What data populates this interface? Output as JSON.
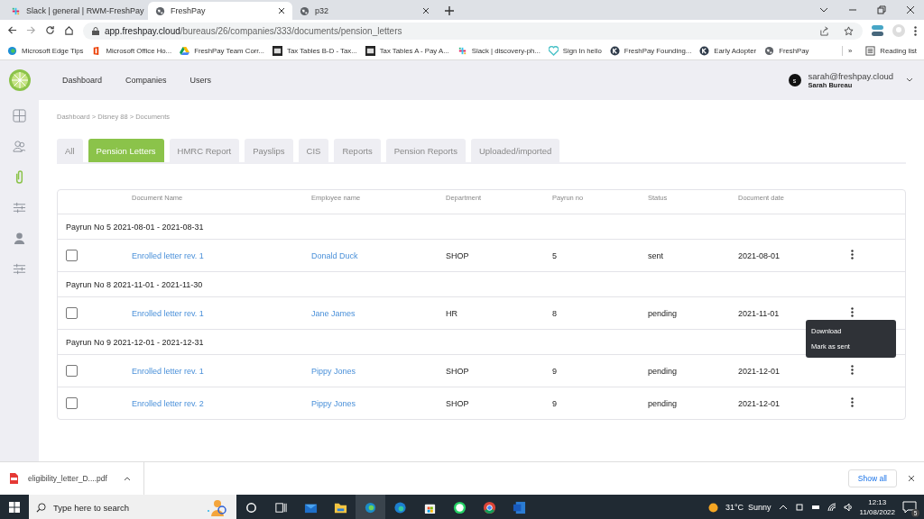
{
  "browser": {
    "tabs": [
      {
        "title": "Slack | general | RWM-FreshPay",
        "selected": false
      },
      {
        "title": "FreshPay",
        "selected": true
      },
      {
        "title": "p32",
        "selected": false
      }
    ],
    "url": {
      "host": "app.freshpay.cloud",
      "path": "/bureaus/26/companies/333/documents/pension_letters"
    },
    "bookmarks": [
      "Microsoft Edge Tips",
      "Microsoft Office Ho...",
      "FreshPay Team Corr...",
      "Tax Tables B-D - Tax...",
      "Tax Tables A - Pay A...",
      "Slack | discovery-ph...",
      "Sign In hello",
      "FreshPay Founding...",
      "Early Adopter",
      "FreshPay"
    ],
    "more": "»",
    "reading_list": "Reading list"
  },
  "app": {
    "nav": [
      "Dashboard",
      "Companies",
      "Users"
    ],
    "user": {
      "initial": "s",
      "email": "sarah@freshpay.cloud",
      "name": "Sarah Bureau"
    },
    "sidebar": [
      {
        "kind": "grid",
        "selected": false
      },
      {
        "kind": "people",
        "selected": false
      },
      {
        "kind": "clip",
        "selected": true
      },
      {
        "kind": "sliders",
        "selected": false
      },
      {
        "kind": "person",
        "selected": false
      },
      {
        "kind": "sliders",
        "selected": false
      }
    ],
    "breadcrumb": "Dashboard > Disney 88 > Documents",
    "tabs": [
      {
        "label": "All",
        "selected": false
      },
      {
        "label": "Pension Letters",
        "selected": true
      },
      {
        "label": "HMRC Report",
        "selected": false
      },
      {
        "label": "Payslips",
        "selected": false
      },
      {
        "label": "CIS",
        "selected": false
      },
      {
        "label": "Reports",
        "selected": false
      },
      {
        "label": "Pension Reports",
        "selected": false
      },
      {
        "label": "Uploaded/imported",
        "selected": false
      }
    ],
    "table": {
      "columns": [
        "Document Name",
        "Employee name",
        "Department",
        "Payrun no",
        "Status",
        "Document date"
      ],
      "groups": [
        {
          "title": "Payrun No 5 2021-08-01 - 2021-08-31",
          "rows": [
            {
              "checked": false,
              "document": "Enrolled letter rev. 1",
              "employee": "Donald Duck",
              "department": "SHOP",
              "payrun": "5",
              "status": "sent",
              "date": "2021-08-01"
            }
          ]
        },
        {
          "title": "Payrun No 8 2021-11-01 - 2021-11-30",
          "rows": [
            {
              "checked": false,
              "document": "Enrolled letter rev. 1",
              "employee": "Jane James",
              "department": "HR",
              "payrun": "8",
              "status": "pending",
              "date": "2021-11-01",
              "menu": [
                "Download",
                "Mark as sent"
              ]
            }
          ]
        },
        {
          "title": "Payrun No 9 2021-12-01 - 2021-12-31",
          "rows": [
            {
              "checked": false,
              "document": "Enrolled letter rev. 1",
              "employee": "Pippy Jones",
              "department": "SHOP",
              "payrun": "9",
              "status": "pending",
              "date": "2021-12-01"
            },
            {
              "checked": false,
              "document": "Enrolled letter rev. 2",
              "employee": "Pippy Jones",
              "department": "SHOP",
              "payrun": "9",
              "status": "pending",
              "date": "2021-12-01"
            }
          ]
        }
      ]
    }
  },
  "downloads": {
    "file": "eligibility_letter_D....pdf",
    "show_all": "Show all"
  },
  "taskbar": {
    "search": "Type here to search",
    "weather": "31°C  Sunny",
    "time": "12:13",
    "date": "11/08/2022",
    "notifications": "5"
  }
}
